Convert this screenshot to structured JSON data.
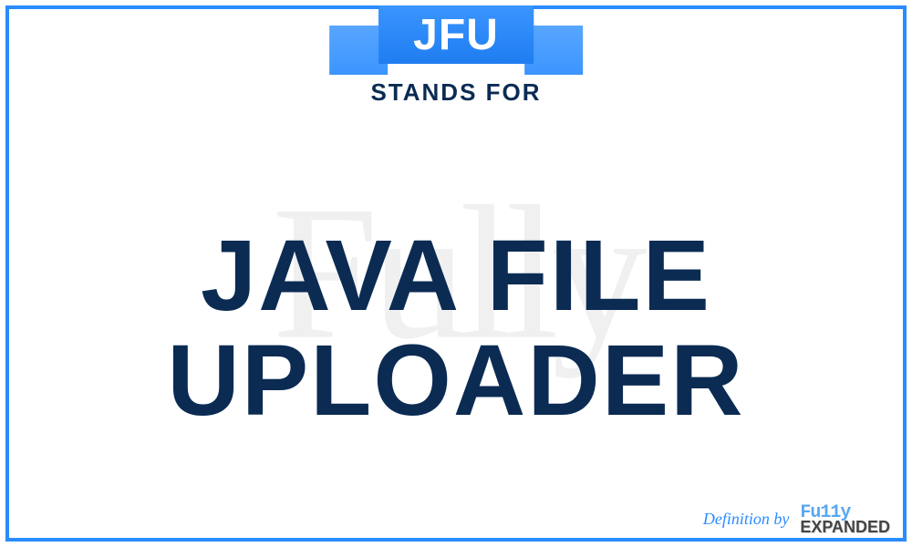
{
  "acronym": "JFU",
  "stands_for_label": "STANDS FOR",
  "definition": "JAVA FILE UPLOADER",
  "watermark": "Fully",
  "footer": {
    "definition_by": "Definition by",
    "brand_top": "Fu11y",
    "brand_bottom": "EXPANDED"
  },
  "colors": {
    "frame": "#2a8cff",
    "ribbon": "#3b95ff",
    "text_primary": "#0b2b53"
  }
}
